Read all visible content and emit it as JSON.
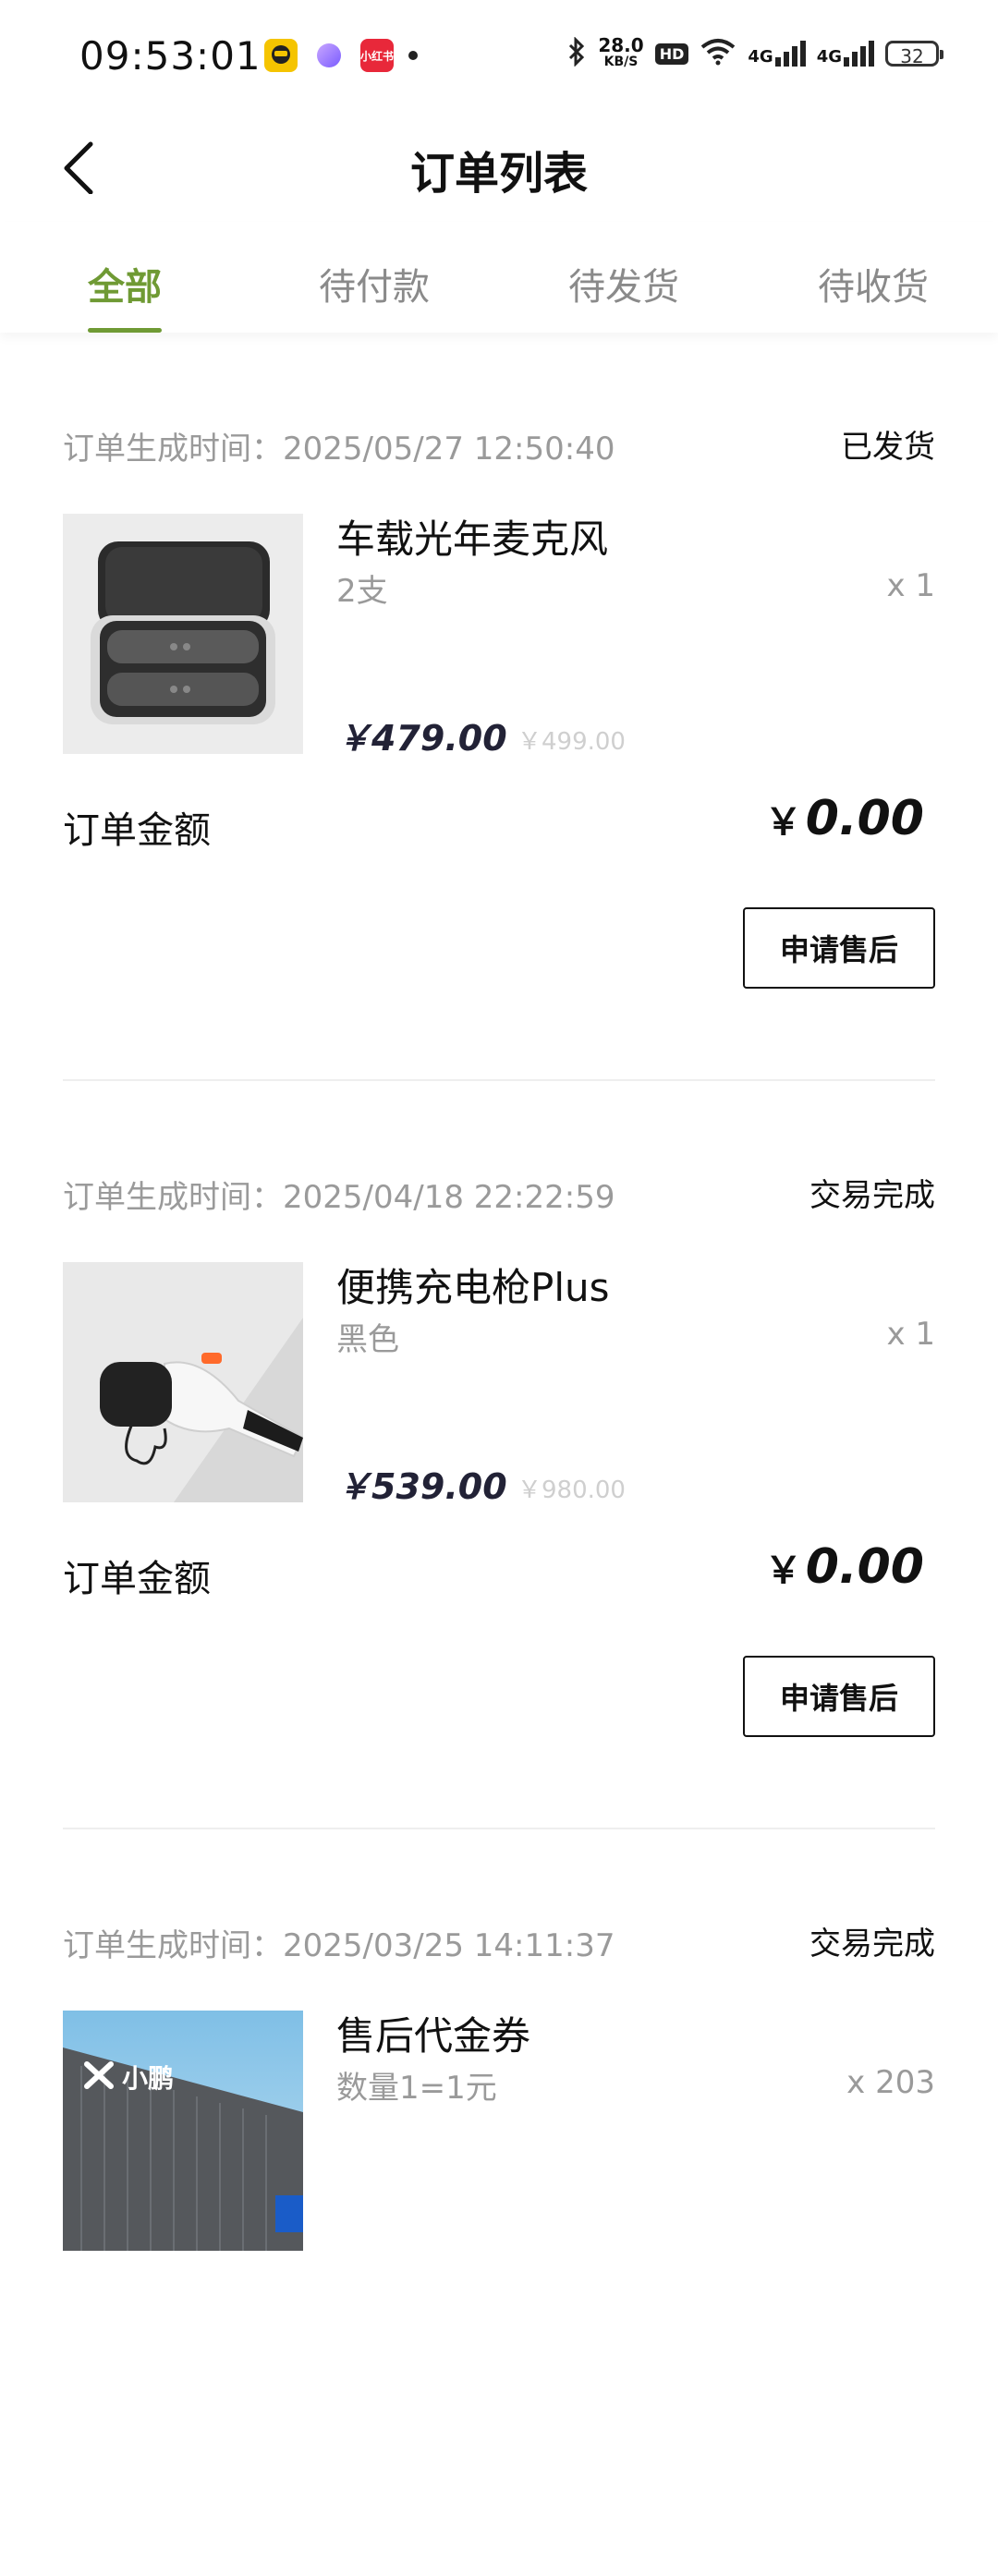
{
  "status_bar": {
    "time": "09:53:01",
    "app_icons": [
      "taxi-app-icon",
      "bubble-app-icon",
      "xiaohongshu-icon"
    ],
    "app3_text": "小红书",
    "net_speed": "28.0",
    "net_unit": "KB/S",
    "hd": "HD",
    "sig1": "4G",
    "sig2": "4G",
    "battery": "32"
  },
  "header": {
    "title": "订单列表"
  },
  "tabs": [
    {
      "label": "全部",
      "active": true
    },
    {
      "label": "待付款",
      "active": false
    },
    {
      "label": "待发货",
      "active": false
    },
    {
      "label": "待收货",
      "active": false
    }
  ],
  "orders": [
    {
      "time_label": "订单生成时间：",
      "time": "2025/05/27 12:50:40",
      "status": "已发货",
      "product_name": "车载光年麦克风",
      "spec": "2支",
      "qty": "x 1",
      "price": "￥479.00",
      "original_price": "￥499.00",
      "amount_label": "订单金额",
      "amount_currency": "￥",
      "amount": "0.00",
      "button": "申请售后",
      "image": "microphone-case-photo"
    },
    {
      "time_label": "订单生成时间：",
      "time": "2025/04/18 22:22:59",
      "status": "交易完成",
      "product_name": "便携充电枪Plus",
      "spec": "黑色",
      "qty": "x 1",
      "price": "￥539.00",
      "original_price": "￥980.00",
      "amount_label": "订单金额",
      "amount_currency": "￥",
      "amount": "0.00",
      "button": "申请售后",
      "image": "charging-gun-photo"
    },
    {
      "time_label": "订单生成时间：",
      "time": "2025/03/25 14:11:37",
      "status": "交易完成",
      "product_name": "售后代金券",
      "spec": "数量1=1元",
      "qty": "x 203",
      "image": "xpeng-store-photo",
      "image_text": "小鹏"
    }
  ],
  "colors": {
    "accent": "#6f9a34",
    "muted": "#9a9a9a",
    "price": "#222236"
  }
}
